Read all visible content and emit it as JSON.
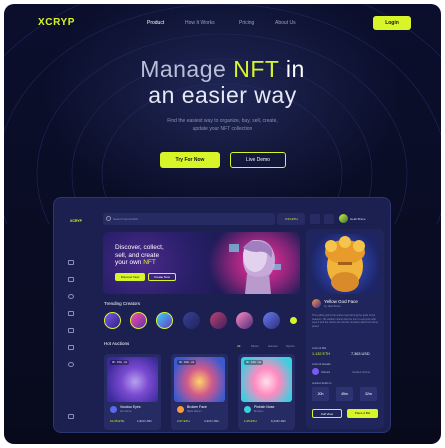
{
  "brand": {
    "logo": "XCRYP",
    "accent": "#d8f52a"
  },
  "nav": {
    "links": [
      "Product",
      "How It Works",
      "Pricing",
      "About Us"
    ],
    "login": "Login"
  },
  "hero": {
    "line1_a": "Manage ",
    "line1_b": "NFT",
    "line1_c": " in",
    "line2": "an easier way",
    "subtitle_1": "Find the easiest way to organize, buy, sell, create,",
    "subtitle_2": "update your NFT collection",
    "primary_button": "Try For Now",
    "secondary_button": "Live Demo"
  },
  "dashboard": {
    "logo": "XCRYP",
    "search_placeholder": "Search items/nftid/...",
    "wallet": "0.54 ETH",
    "user_name": "Heidi Brace",
    "banner": {
      "line1": "Discover, collect,",
      "line2": "sell, and create",
      "line3_a": "your own ",
      "line3_b": "NFT",
      "button1": "Discover Now",
      "button2": "Create Now"
    },
    "trending_title": "Trending Creators",
    "hot_title": "Hot Auctions",
    "tabs": [
      "All",
      "Music",
      "Games",
      "Sports"
    ],
    "cards": [
      {
        "time": "3h : 15m : 2s",
        "name": "Voodoo Eyes",
        "by": "Alex Berns",
        "eth": "10.45 ETH",
        "usd": "1,820 USD"
      },
      {
        "time": "3h : 15m : 2s",
        "name": "Broken Face",
        "by": "Wade Warren",
        "eth": "2.07 ETH",
        "usd": "3,334 USD"
      },
      {
        "time": "3h : 15m : 2s",
        "name": "Pinkish Nose",
        "by": "Brooklyn",
        "eth": "1.05 ETH",
        "usd": "6,248 USD"
      }
    ],
    "featured": {
      "title": "Yellow God Face",
      "by": "by Jake Brace",
      "description": "This yellow god is the ancient god among the gods of the heavens. His wisdom shines like the sun to everyone who sees it and the stories are told for centuries about his divine power.",
      "current_bid_label": "Current Bid",
      "eth": "1.132 ETH",
      "usd": "7,363 USD",
      "details_label": "Current Details",
      "owner": "Ahmed",
      "owner_label": "Verified Owner",
      "auction_label": "Auction Ends In",
      "time": [
        "20h",
        "45m",
        "32m"
      ],
      "button1": "Full View",
      "button2": "Place A Bid"
    }
  }
}
